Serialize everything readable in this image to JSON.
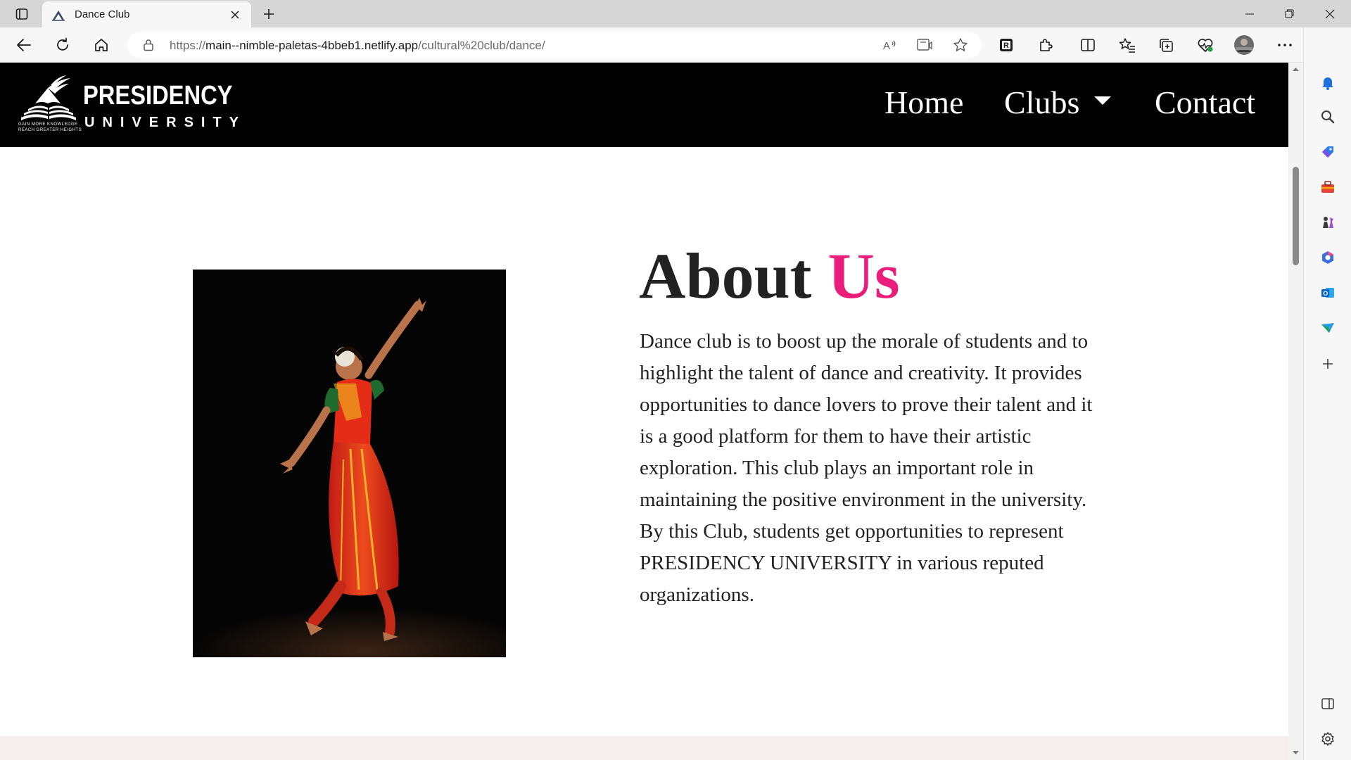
{
  "browser": {
    "tab": {
      "title": "Dance Club"
    },
    "url": {
      "scheme": "https://",
      "host": "main--nimble-paletas-4bbeb1.netlify.app",
      "path": "/cultural%20club/dance/"
    },
    "icons": {
      "tab_actions": "tab-actions-icon",
      "favicon": "presidency-logo-icon",
      "close": "close-icon",
      "new_tab": "plus-icon",
      "back": "back-arrow-icon",
      "refresh": "refresh-icon",
      "home": "home-icon",
      "lock": "lock-icon",
      "read_aloud": "read-aloud-icon",
      "immersive_reader": "immersive-reader-icon",
      "favorite": "star-icon",
      "ext_r": "extension-r-icon",
      "extensions": "puzzle-icon",
      "split": "split-screen-icon",
      "favorites": "favorites-icon",
      "collections": "collections-icon",
      "performance": "heart-pulse-icon",
      "profile": "profile-avatar",
      "more": "more-icon",
      "copilot": "copilot-icon"
    }
  },
  "sidebar": {
    "items": [
      "bell-icon",
      "search-icon",
      "tag-icon",
      "toolbox-icon",
      "chess-icon",
      "m365-icon",
      "outlook-icon",
      "send-icon",
      "add-icon",
      "panel-icon",
      "settings-icon"
    ]
  },
  "site": {
    "logo": {
      "name": "PRESIDENCY",
      "sub": "UNIVERSITY",
      "tagline1": "GAIN MORE KNOWLEDGE",
      "tagline2": "REACH GREATER HEIGHTS"
    },
    "nav": {
      "home": "Home",
      "clubs": "Clubs",
      "contact": "Contact"
    },
    "about": {
      "heading_main": "About",
      "heading_accent": "Us",
      "body": "Dance club is to boost up the morale of students and to highlight the talent of dance and creativity. It provides opportunities to dance lovers to prove their talent and it is a good platform for them to have their artistic exploration. This club plays an important role in maintaining the positive environment in the university. By this Club, students get opportunities to represent PRESIDENCY UNIVERSITY in various reputed organizations.",
      "image": "bharatanatyam-dancer-photo"
    }
  },
  "colors": {
    "accent": "#e91e7a",
    "navbar": "#000000",
    "text": "#222222"
  }
}
